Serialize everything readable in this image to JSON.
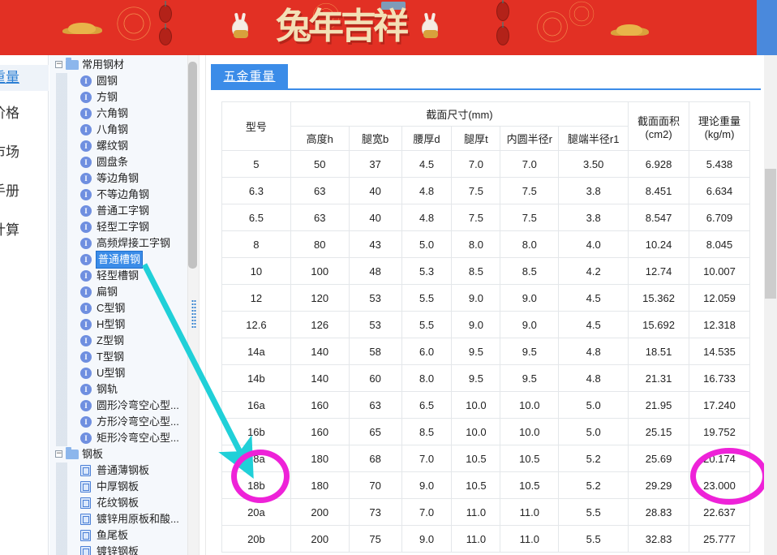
{
  "banner": {
    "title": "兔年吉祥",
    "background_color": "#e23024",
    "title_color": "#f3e0b6"
  },
  "left_rail": {
    "items": [
      {
        "label": "重量",
        "active": true
      },
      {
        "label": "价格",
        "active": false
      },
      {
        "label": "市场",
        "active": false
      },
      {
        "label": "手册",
        "active": false
      },
      {
        "label": "计算",
        "active": false
      }
    ],
    "active_color": "#2b7fd4"
  },
  "tree": {
    "nodes": [
      {
        "label": "常用钢材",
        "icon": "folder-icon",
        "level": 0,
        "expander": "−",
        "selected": false
      },
      {
        "label": "圆钢",
        "icon": "i-beam-icon",
        "level": 1,
        "selected": false
      },
      {
        "label": "方钢",
        "icon": "i-beam-icon",
        "level": 1,
        "selected": false
      },
      {
        "label": "六角钢",
        "icon": "i-beam-icon",
        "level": 1,
        "selected": false
      },
      {
        "label": "八角钢",
        "icon": "i-beam-icon",
        "level": 1,
        "selected": false
      },
      {
        "label": "螺纹钢",
        "icon": "i-beam-icon",
        "level": 1,
        "selected": false
      },
      {
        "label": "圆盘条",
        "icon": "i-beam-icon",
        "level": 1,
        "selected": false
      },
      {
        "label": "等边角钢",
        "icon": "i-beam-icon",
        "level": 1,
        "selected": false
      },
      {
        "label": "不等边角钢",
        "icon": "i-beam-icon",
        "level": 1,
        "selected": false
      },
      {
        "label": "普通工字钢",
        "icon": "i-beam-icon",
        "level": 1,
        "selected": false
      },
      {
        "label": "轻型工字钢",
        "icon": "i-beam-icon",
        "level": 1,
        "selected": false
      },
      {
        "label": "高频焊接工字钢",
        "icon": "i-beam-icon",
        "level": 1,
        "selected": false
      },
      {
        "label": "普通槽钢",
        "icon": "i-beam-icon",
        "level": 1,
        "selected": true
      },
      {
        "label": "轻型槽钢",
        "icon": "i-beam-icon",
        "level": 1,
        "selected": false
      },
      {
        "label": "扁钢",
        "icon": "i-beam-icon",
        "level": 1,
        "selected": false
      },
      {
        "label": "C型钢",
        "icon": "i-beam-icon",
        "level": 1,
        "selected": false
      },
      {
        "label": "H型钢",
        "icon": "i-beam-icon",
        "level": 1,
        "selected": false
      },
      {
        "label": "Z型钢",
        "icon": "i-beam-icon",
        "level": 1,
        "selected": false
      },
      {
        "label": "T型钢",
        "icon": "i-beam-icon",
        "level": 1,
        "selected": false
      },
      {
        "label": "U型钢",
        "icon": "i-beam-icon",
        "level": 1,
        "selected": false
      },
      {
        "label": "钢轨",
        "icon": "i-beam-icon",
        "level": 1,
        "selected": false
      },
      {
        "label": "圆形冷弯空心型...",
        "icon": "i-beam-icon",
        "level": 1,
        "selected": false
      },
      {
        "label": "方形冷弯空心型...",
        "icon": "i-beam-icon",
        "level": 1,
        "selected": false
      },
      {
        "label": "矩形冷弯空心型...",
        "icon": "i-beam-icon",
        "level": 1,
        "selected": false
      },
      {
        "label": "钢板",
        "icon": "folder-icon",
        "level": 0,
        "expander": "−",
        "selected": false
      },
      {
        "label": "普通薄钢板",
        "icon": "plate-icon",
        "level": 1,
        "selected": false
      },
      {
        "label": "中厚钢板",
        "icon": "plate-icon",
        "level": 1,
        "selected": false
      },
      {
        "label": "花纹钢板",
        "icon": "plate-icon",
        "level": 1,
        "selected": false
      },
      {
        "label": "镀锌用原板和酸...",
        "icon": "plate-icon",
        "level": 1,
        "selected": false
      },
      {
        "label": "鱼尾板",
        "icon": "plate-icon",
        "level": 1,
        "selected": false
      },
      {
        "label": "镀锌钢板",
        "icon": "plate-icon",
        "level": 1,
        "selected": false
      }
    ]
  },
  "tabs": [
    {
      "label": "五金重量",
      "active": true
    }
  ],
  "table": {
    "header_groups": [
      {
        "label": "型号",
        "rowspan": 2
      },
      {
        "label": "截面尺寸(mm)",
        "colspan": 6
      },
      {
        "label": "截面面积",
        "sub": "(cm2)",
        "rowspan": 2
      },
      {
        "label": "理论重量",
        "sub": "(kg/m)",
        "rowspan": 2
      }
    ],
    "sub_headers": [
      "高度h",
      "腿宽b",
      "腰厚d",
      "腿厚t",
      "内圆半径r",
      "腿端半径r1"
    ],
    "col_label_model": "型号",
    "col_label_dims": "截面尺寸(mm)",
    "col_label_area": "截面面积",
    "col_label_area_unit": "(cm2)",
    "col_label_weight": "理论重量",
    "col_label_weight_unit": "(kg/m)",
    "rows": [
      [
        "5",
        "50",
        "37",
        "4.5",
        "7.0",
        "7.0",
        "3.50",
        "6.928",
        "5.438"
      ],
      [
        "6.3",
        "63",
        "40",
        "4.8",
        "7.5",
        "7.5",
        "3.8",
        "8.451",
        "6.634"
      ],
      [
        "6.5",
        "63",
        "40",
        "4.8",
        "7.5",
        "7.5",
        "3.8",
        "8.547",
        "6.709"
      ],
      [
        "8",
        "80",
        "43",
        "5.0",
        "8.0",
        "8.0",
        "4.0",
        "10.24",
        "8.045"
      ],
      [
        "10",
        "100",
        "48",
        "5.3",
        "8.5",
        "8.5",
        "4.2",
        "12.74",
        "10.007"
      ],
      [
        "12",
        "120",
        "53",
        "5.5",
        "9.0",
        "9.0",
        "4.5",
        "15.362",
        "12.059"
      ],
      [
        "12.6",
        "126",
        "53",
        "5.5",
        "9.0",
        "9.0",
        "4.5",
        "15.692",
        "12.318"
      ],
      [
        "14a",
        "140",
        "58",
        "6.0",
        "9.5",
        "9.5",
        "4.8",
        "18.51",
        "14.535"
      ],
      [
        "14b",
        "140",
        "60",
        "8.0",
        "9.5",
        "9.5",
        "4.8",
        "21.31",
        "16.733"
      ],
      [
        "16a",
        "160",
        "63",
        "6.5",
        "10.0",
        "10.0",
        "5.0",
        "21.95",
        "17.240"
      ],
      [
        "16b",
        "160",
        "65",
        "8.5",
        "10.0",
        "10.0",
        "5.0",
        "25.15",
        "19.752"
      ],
      [
        "18a",
        "180",
        "68",
        "7.0",
        "10.5",
        "10.5",
        "5.2",
        "25.69",
        "20.174"
      ],
      [
        "18b",
        "180",
        "70",
        "9.0",
        "10.5",
        "10.5",
        "5.2",
        "29.29",
        "23.000"
      ],
      [
        "20a",
        "200",
        "73",
        "7.0",
        "11.0",
        "11.0",
        "5.5",
        "28.83",
        "22.637"
      ],
      [
        "20b",
        "200",
        "75",
        "9.0",
        "11.0",
        "11.0",
        "5.5",
        "32.83",
        "25.777"
      ]
    ]
  },
  "annotations": {
    "highlight_color": "#ee22d8",
    "arrow_color": "#20d0d8",
    "circles": [
      {
        "name": "model-18ab-circle"
      },
      {
        "name": "weight-18ab-circle"
      }
    ]
  }
}
